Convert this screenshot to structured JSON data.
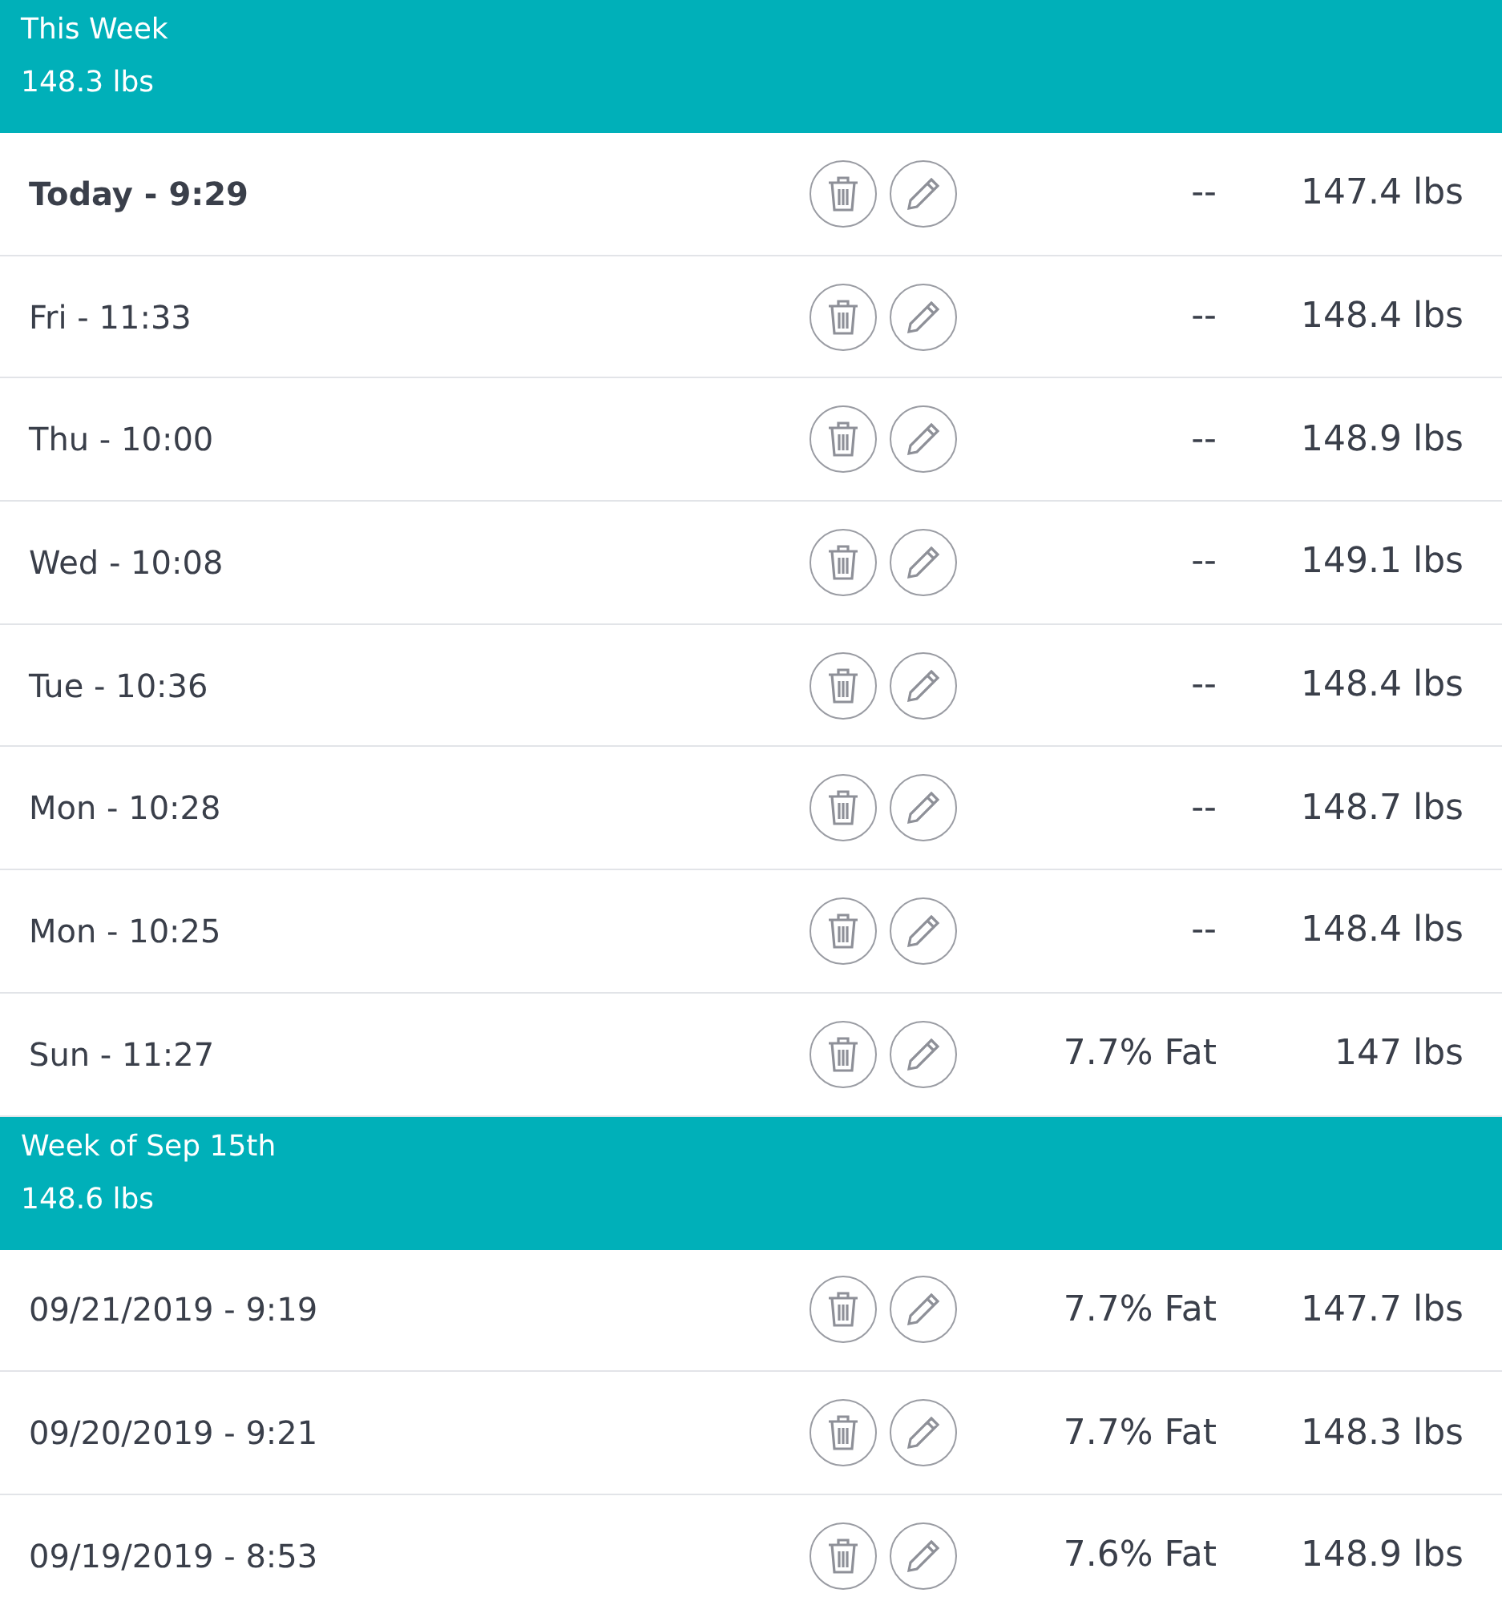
{
  "weeks": [
    {
      "title": "This Week",
      "average": "148.3 lbs",
      "entries": [
        {
          "time": "Today - 9:29",
          "current": true,
          "fat": "--",
          "weight": "147.4 lbs"
        },
        {
          "time": "Fri - 11:33",
          "current": false,
          "fat": "--",
          "weight": "148.4 lbs"
        },
        {
          "time": "Thu - 10:00",
          "current": false,
          "fat": "--",
          "weight": "148.9 lbs"
        },
        {
          "time": "Wed - 10:08",
          "current": false,
          "fat": "--",
          "weight": "149.1 lbs"
        },
        {
          "time": "Tue - 10:36",
          "current": false,
          "fat": "--",
          "weight": "148.4 lbs"
        },
        {
          "time": "Mon - 10:28",
          "current": false,
          "fat": "--",
          "weight": "148.7 lbs"
        },
        {
          "time": "Mon - 10:25",
          "current": false,
          "fat": "--",
          "weight": "148.4 lbs"
        },
        {
          "time": "Sun - 11:27",
          "current": false,
          "fat": "7.7% Fat",
          "weight": "147 lbs"
        }
      ]
    },
    {
      "title": "Week of Sep 15th",
      "average": "148.6 lbs",
      "entries": [
        {
          "time": "09/21/2019 - 9:19",
          "current": false,
          "fat": "7.7% Fat",
          "weight": "147.7 lbs"
        },
        {
          "time": "09/20/2019 - 9:21",
          "current": false,
          "fat": "7.7% Fat",
          "weight": "148.3 lbs"
        },
        {
          "time": "09/19/2019 - 8:53",
          "current": false,
          "fat": "7.6% Fat",
          "weight": "148.9 lbs"
        }
      ]
    }
  ]
}
